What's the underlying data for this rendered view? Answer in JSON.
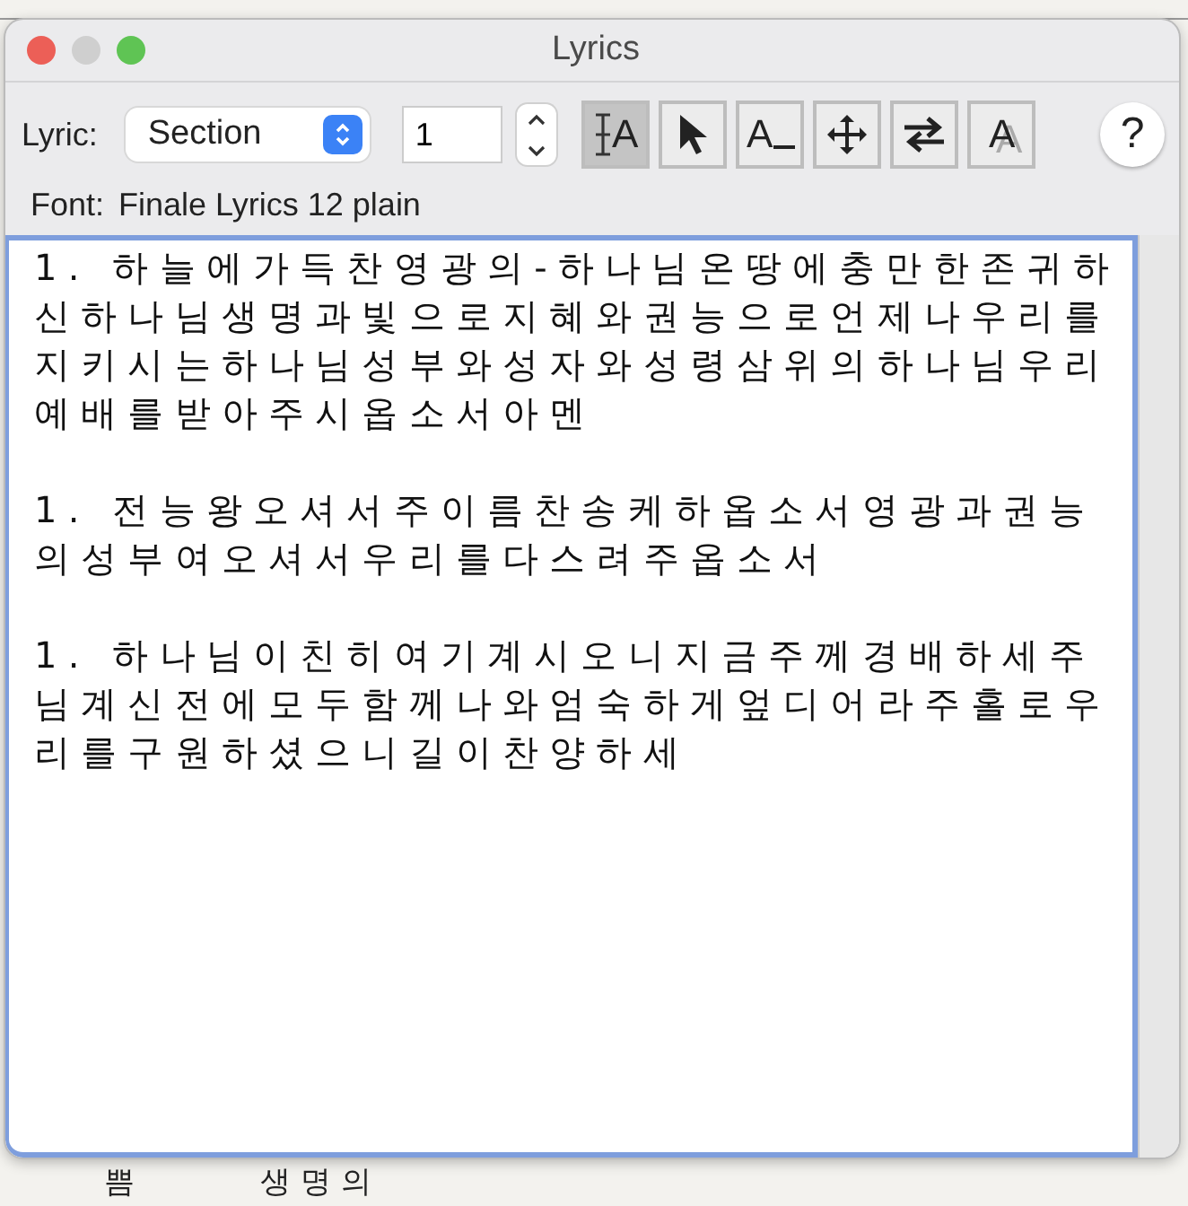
{
  "window": {
    "title": "Lyrics"
  },
  "toolbar": {
    "lyric_label": "Lyric:",
    "lyric_type": "Section",
    "number": "1",
    "tools": [
      {
        "kind": "text-cursor",
        "glyph": "A",
        "selected": true
      },
      {
        "kind": "arrow",
        "selected": false
      },
      {
        "kind": "baseline",
        "glyph": "A",
        "selected": false
      },
      {
        "kind": "move",
        "selected": false
      },
      {
        "kind": "swap",
        "selected": false
      },
      {
        "kind": "shadow",
        "glyph": "A",
        "selected": false
      }
    ],
    "help": "?"
  },
  "font": {
    "label": "Font:",
    "value": "Finale Lyrics 12 plain"
  },
  "lyrics": [
    "1. 하늘에가득찬영광의-하나님온땅에충만한존귀하신하나님생명과빛으로지혜와권능으로언제나우리를지키시는하나님성부와성자와성령삼위의하나님우리예배를받아주시옵소서아멘",
    "1. 전능왕오셔서주이름찬송케하옵소서영광과권능의성부여오셔서우리를다스려주옵소서",
    "1. 하나님이친히여기계시오니지금주께경배하세주님계신전에모두함께나와엄숙하게엎디어라주홀로우리를구원하셨으니길이찬양하세"
  ],
  "background_score": [
    "쁨",
    "생 명 의"
  ]
}
